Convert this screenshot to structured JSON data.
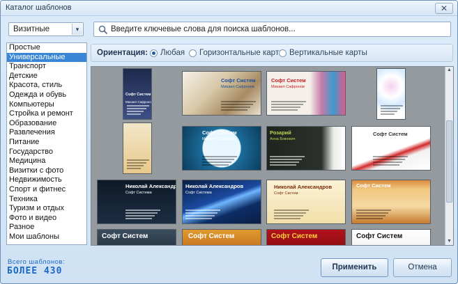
{
  "window": {
    "title": "Каталог шаблонов",
    "close_glyph": "✕"
  },
  "category_select": {
    "value": "Визитные",
    "arrow": "▾"
  },
  "search": {
    "placeholder": "Введите ключевые слова для поиска шаблонов..."
  },
  "categories": [
    "Простые",
    "Универсальные",
    "Транспорт",
    "Детские",
    "Красота, стиль",
    "Одежда и обувь",
    "Компьютеры",
    "Стройка и ремонт",
    "Образование",
    "Развлечения",
    "Питание",
    "Государство",
    "Медицина",
    "Визитки с фото",
    "Недвижимость",
    "Спорт и фитнес",
    "Техника",
    "Туризм и отдых",
    "Фото и видео",
    "Разное",
    "Мои шаблоны"
  ],
  "selected_category_index": 1,
  "orientation": {
    "label": "Ориентация:",
    "options": [
      "Любая",
      "Горизонтальные карты",
      "Вертикальные карты"
    ],
    "selected_index": 0
  },
  "templates": [
    {
      "name": "Софт Систем",
      "subtitle": "Михаил Сафронов",
      "style": "navy-vertical"
    },
    {
      "name": "Софт Систем",
      "subtitle": "Михаил Сафронов",
      "style": "architecture"
    },
    {
      "name": "Софт Систем",
      "subtitle": "Михаил Сафронов",
      "style": "gifts"
    },
    {
      "name": "",
      "subtitle": "",
      "style": "circles-vertical"
    },
    {
      "name": "",
      "subtitle": "",
      "style": "ornament-vertical"
    },
    {
      "name": "Софт Систем",
      "subtitle": "Михаил Сафронов",
      "style": "bubbles"
    },
    {
      "name": "Розарий",
      "subtitle": "Анна Божевич",
      "style": "calla"
    },
    {
      "name": "Софт Систем",
      "subtitle": "",
      "style": "red-swoosh"
    },
    {
      "name": "Николай Александров",
      "subtitle": "Софт Система",
      "style": "dark-blue"
    },
    {
      "name": "Николай Александров",
      "subtitle": "Софт Система",
      "style": "blue-wave"
    },
    {
      "name": "Николай Александров",
      "subtitle": "Софт Систем",
      "style": "cream"
    },
    {
      "name": "Софт Систем",
      "subtitle": "",
      "style": "parchment"
    },
    {
      "name": "Софт Систем",
      "subtitle": "",
      "style": "partial-grey"
    },
    {
      "name": "Софт Систем",
      "subtitle": "",
      "style": "partial-orange"
    },
    {
      "name": "Софт Систем",
      "subtitle": "",
      "style": "partial-red"
    },
    {
      "name": "Софт Систем",
      "subtitle": "",
      "style": "partial-white"
    }
  ],
  "footer": {
    "count_label": "Всего шаблонов:",
    "count_value": "БОЛЕЕ 430",
    "apply_label": "Применить",
    "cancel_label": "Отмена"
  }
}
